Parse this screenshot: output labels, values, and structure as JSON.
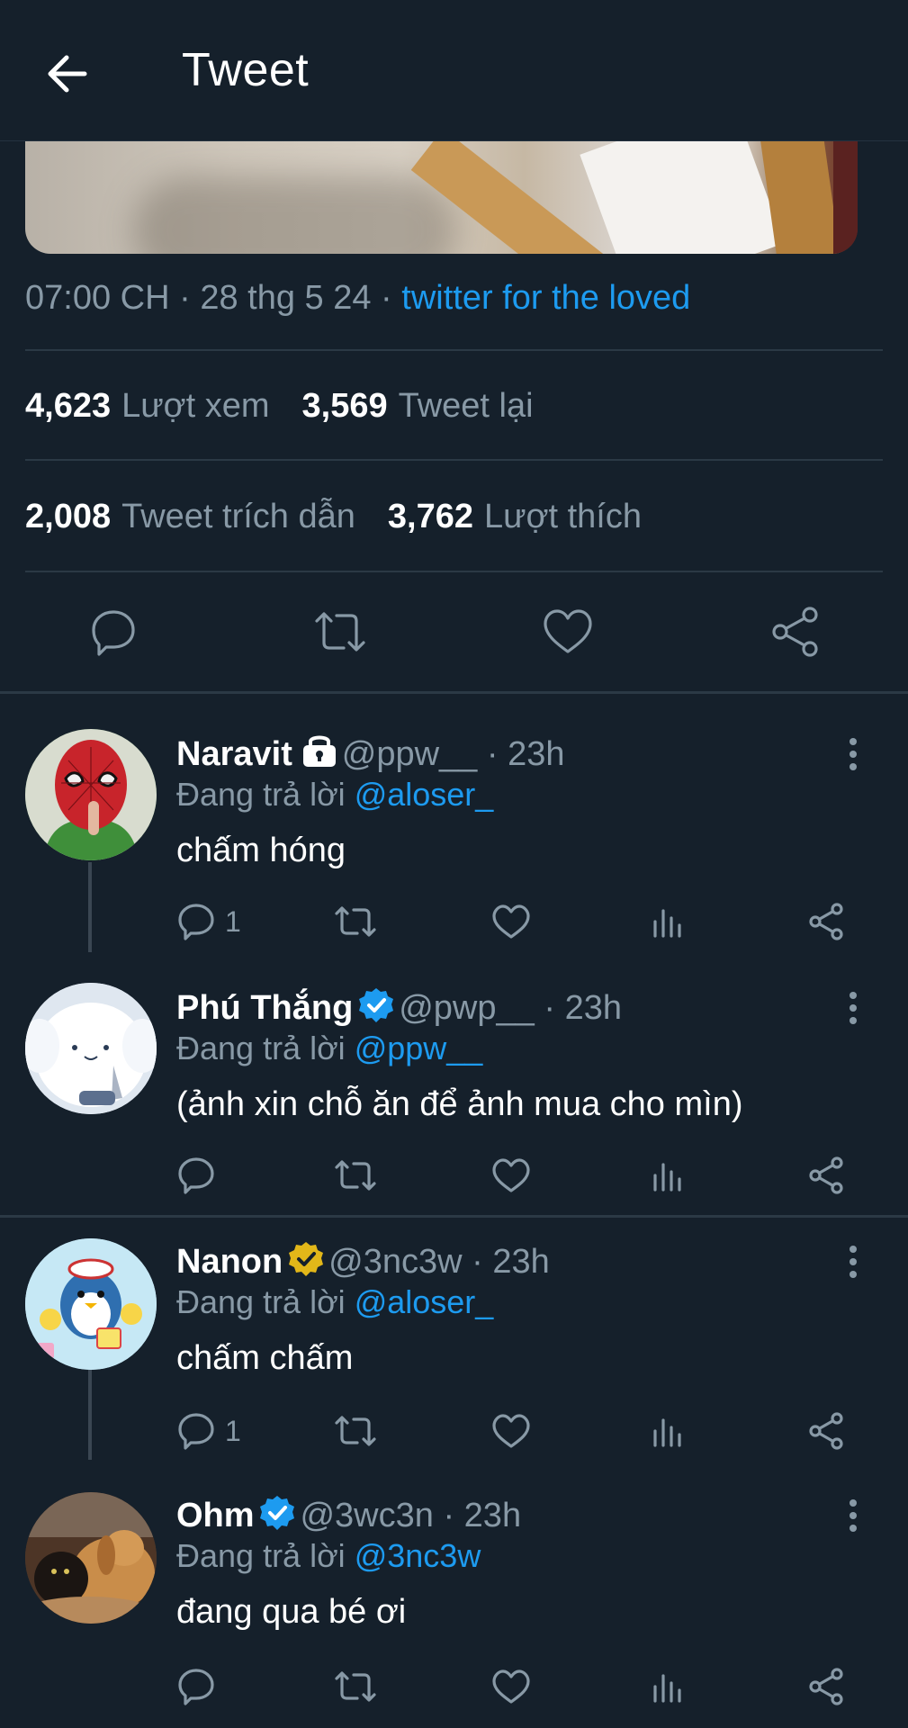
{
  "header": {
    "title": "Tweet",
    "back_icon": "arrow-left-icon"
  },
  "tweet": {
    "time": "07:00 CH",
    "date": "28 thg 5 24",
    "source": "twitter for the loved",
    "stats": {
      "views_count": "4,623",
      "views_label": "Lượt xem",
      "retweets_count": "3,569",
      "retweets_label": "Tweet lại",
      "quotes_count": "2,008",
      "quotes_label": "Tweet trích dẫn",
      "likes_count": "3,762",
      "likes_label": "Lượt thích"
    }
  },
  "colors": {
    "background": "#15202b",
    "accent": "#1d9bf0",
    "muted": "#8899a6",
    "verified_blue": "#1d9bf0",
    "verified_gold": "#e2b719"
  },
  "replies": [
    {
      "name": "Naravit",
      "badge": "lock-icon",
      "handle": "@ppw__",
      "time": "23h",
      "replying_prefix": "Đang trả lời",
      "replying_to": "@aloser_",
      "text": "chấm hóng",
      "reply_count": "1"
    },
    {
      "name": "Phú Thắng",
      "badge": "verified-blue-icon",
      "handle": "@pwp__",
      "time": "23h",
      "replying_prefix": "Đang trả lời",
      "replying_to": "@ppw__",
      "text": "(ảnh xin chỗ ăn để ảnh mua cho mìn)",
      "reply_count": ""
    },
    {
      "name": "Nanon",
      "badge": "verified-gold-icon",
      "handle": "@3nc3w",
      "time": "23h",
      "replying_prefix": "Đang trả lời",
      "replying_to": "@aloser_",
      "text": "chấm chấm",
      "reply_count": "1"
    },
    {
      "name": "Ohm",
      "badge": "verified-blue-icon",
      "handle": "@3wc3n",
      "time": "23h",
      "replying_prefix": "Đang trả lời",
      "replying_to": "@3nc3w",
      "text": "đang qua bé ơi",
      "reply_count": ""
    }
  ]
}
